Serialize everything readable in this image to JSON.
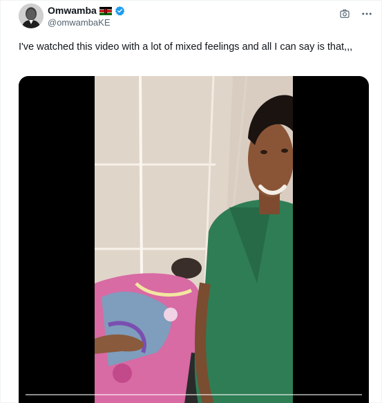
{
  "tweet": {
    "author": {
      "display_name": "Omwamba",
      "handle": "@omwambaKE",
      "flag_icon": "kenya-flag-icon",
      "verified_icon": "verified-badge-icon",
      "verified_color": "#1d9bf0"
    },
    "text": "I've watched this video with a lot of mixed feelings and all I can say is that,,,",
    "actions": {
      "grok_icon": "image-camera-icon",
      "more_icon": "more-dots-icon"
    },
    "media": {
      "type": "video"
    }
  }
}
